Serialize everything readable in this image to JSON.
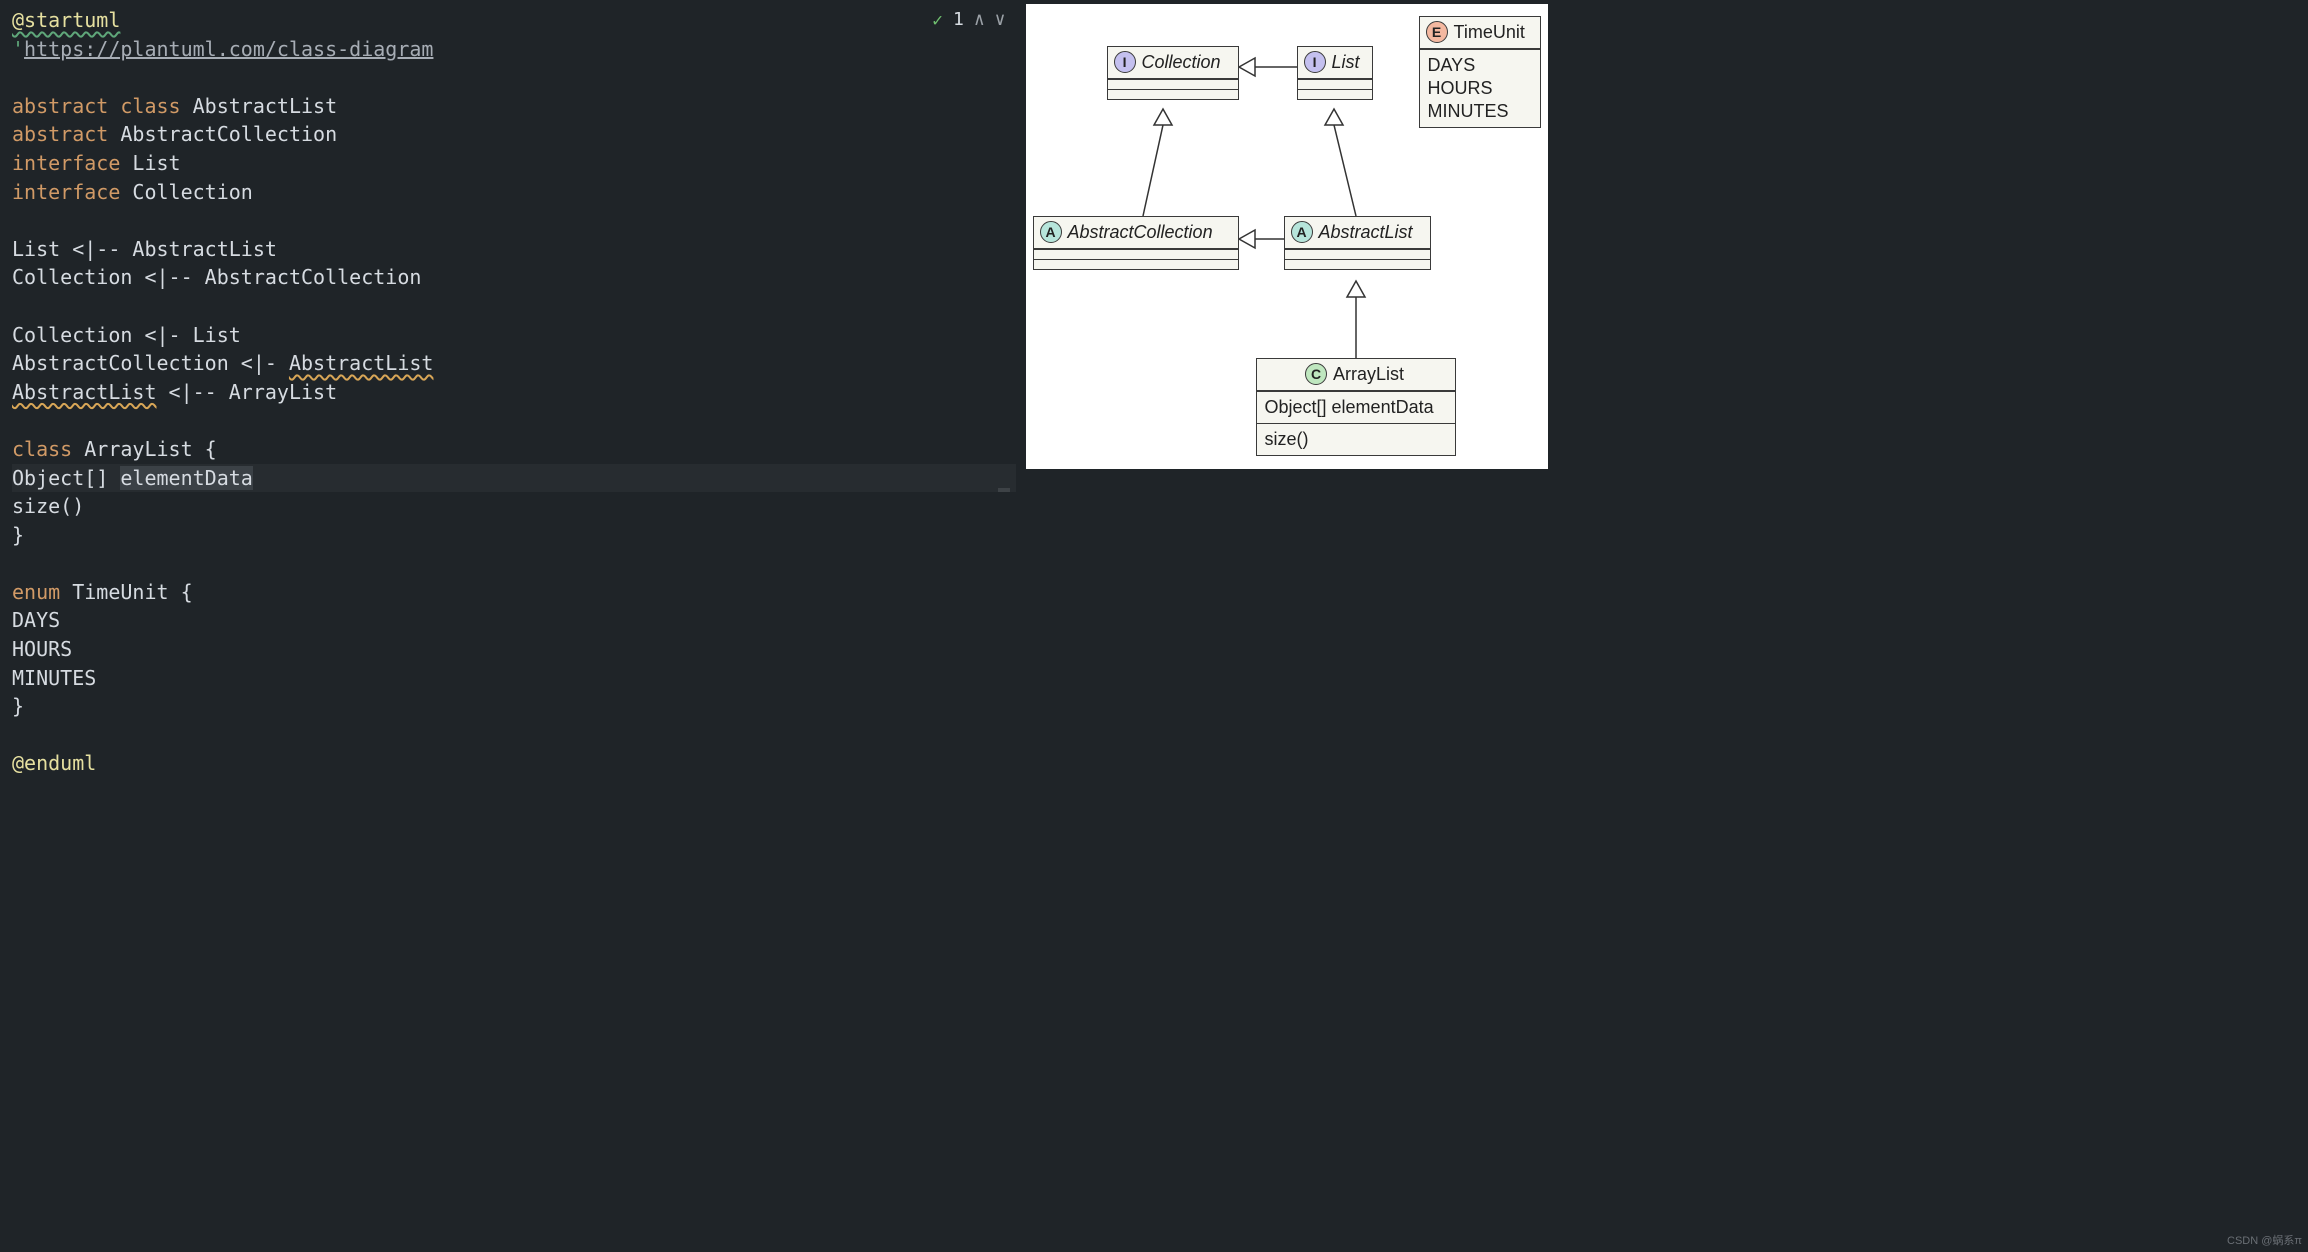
{
  "editor": {
    "inspection": {
      "count": "1"
    },
    "code": {
      "l0_dir": "@startuml",
      "l1_prefix": "'",
      "l1_url": "https://plantuml.com/class-diagram",
      "l3_kw": "abstract",
      "l3_kw2": "class",
      "l3_id": "AbstractList",
      "l4_kw": "abstract",
      "l4_id": "AbstractCollection",
      "l5_kw": "interface",
      "l5_id": "List",
      "l6_kw": "interface",
      "l6_id": "Collection",
      "l8": "List <|-- AbstractList",
      "l9": "Collection <|-- AbstractCollection",
      "l11": "Collection <|- List",
      "l12_a": "AbstractCollection <|- ",
      "l12_b": "AbstractList",
      "l13_a": "AbstractList",
      "l13_b": " <|-- ArrayList",
      "l15_kw": "class",
      "l15_id": "ArrayList {",
      "l16_a": "Object[] ",
      "l16_b": "elementData",
      "l17": "size()",
      "l18": "}",
      "l20_kw": "enum",
      "l20_id": "TimeUnit {",
      "l21": "DAYS",
      "l22": "HOURS",
      "l23": "MINUTES",
      "l24": "}",
      "l26_dir": "@enduml"
    }
  },
  "diagram": {
    "nodes": {
      "collection": {
        "badge": "I",
        "title": "Collection"
      },
      "list": {
        "badge": "I",
        "title": "List"
      },
      "abstractCollection": {
        "badge": "A",
        "title": "AbstractCollection"
      },
      "abstractList": {
        "badge": "A",
        "title": "AbstractList"
      },
      "arrayList": {
        "badge": "C",
        "title": "ArrayList",
        "fields": [
          "Object[] elementData"
        ],
        "methods": [
          "size()"
        ]
      },
      "timeUnit": {
        "badge": "E",
        "title": "TimeUnit",
        "values": [
          "DAYS",
          "HOURS",
          "MINUTES"
        ]
      }
    }
  },
  "watermark": "CSDN @蜗系π"
}
